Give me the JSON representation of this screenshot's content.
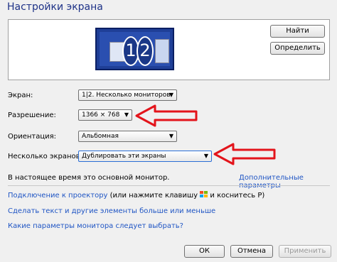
{
  "window": {
    "title": "Настройки экрана"
  },
  "preview": {
    "monitor_numbers": [
      "1",
      "2"
    ],
    "identify_button": "Найти",
    "detect_button": "Определить"
  },
  "settings": {
    "screen_label": "Экран:",
    "screen_value": "1|2. Несколько мониторов",
    "resolution_label": "Разрешение:",
    "resolution_value": "1366 × 768",
    "orientation_label": "Ориентация:",
    "orientation_value": "Альбомная",
    "multiple_label": "Несколько экранов:",
    "multiple_value": "Дублировать эти экраны"
  },
  "status": {
    "main_monitor_text": "В настоящее время это основной монитор.",
    "advanced_link": "Дополнительные параметры"
  },
  "links": {
    "projector_link": "Подключение к проектору",
    "projector_hint_1": "(или нажмите клавишу",
    "projector_hint_2": "и коснитесь P)",
    "bigger_text_link": "Сделать текст и другие элементы больше или меньше",
    "which_settings_link": "Какие параметры монитора следует выбрать?"
  },
  "footer": {
    "ok_button": "ОК",
    "cancel_button": "Отмена",
    "apply_button": "Применить"
  },
  "colors": {
    "title": "#1e3287",
    "link": "#1f55c4",
    "arrow": "#e3141b",
    "monitor": "#1f3f97"
  },
  "icons": [
    "windows-key-icon",
    "dropdown-arrow-icon"
  ]
}
